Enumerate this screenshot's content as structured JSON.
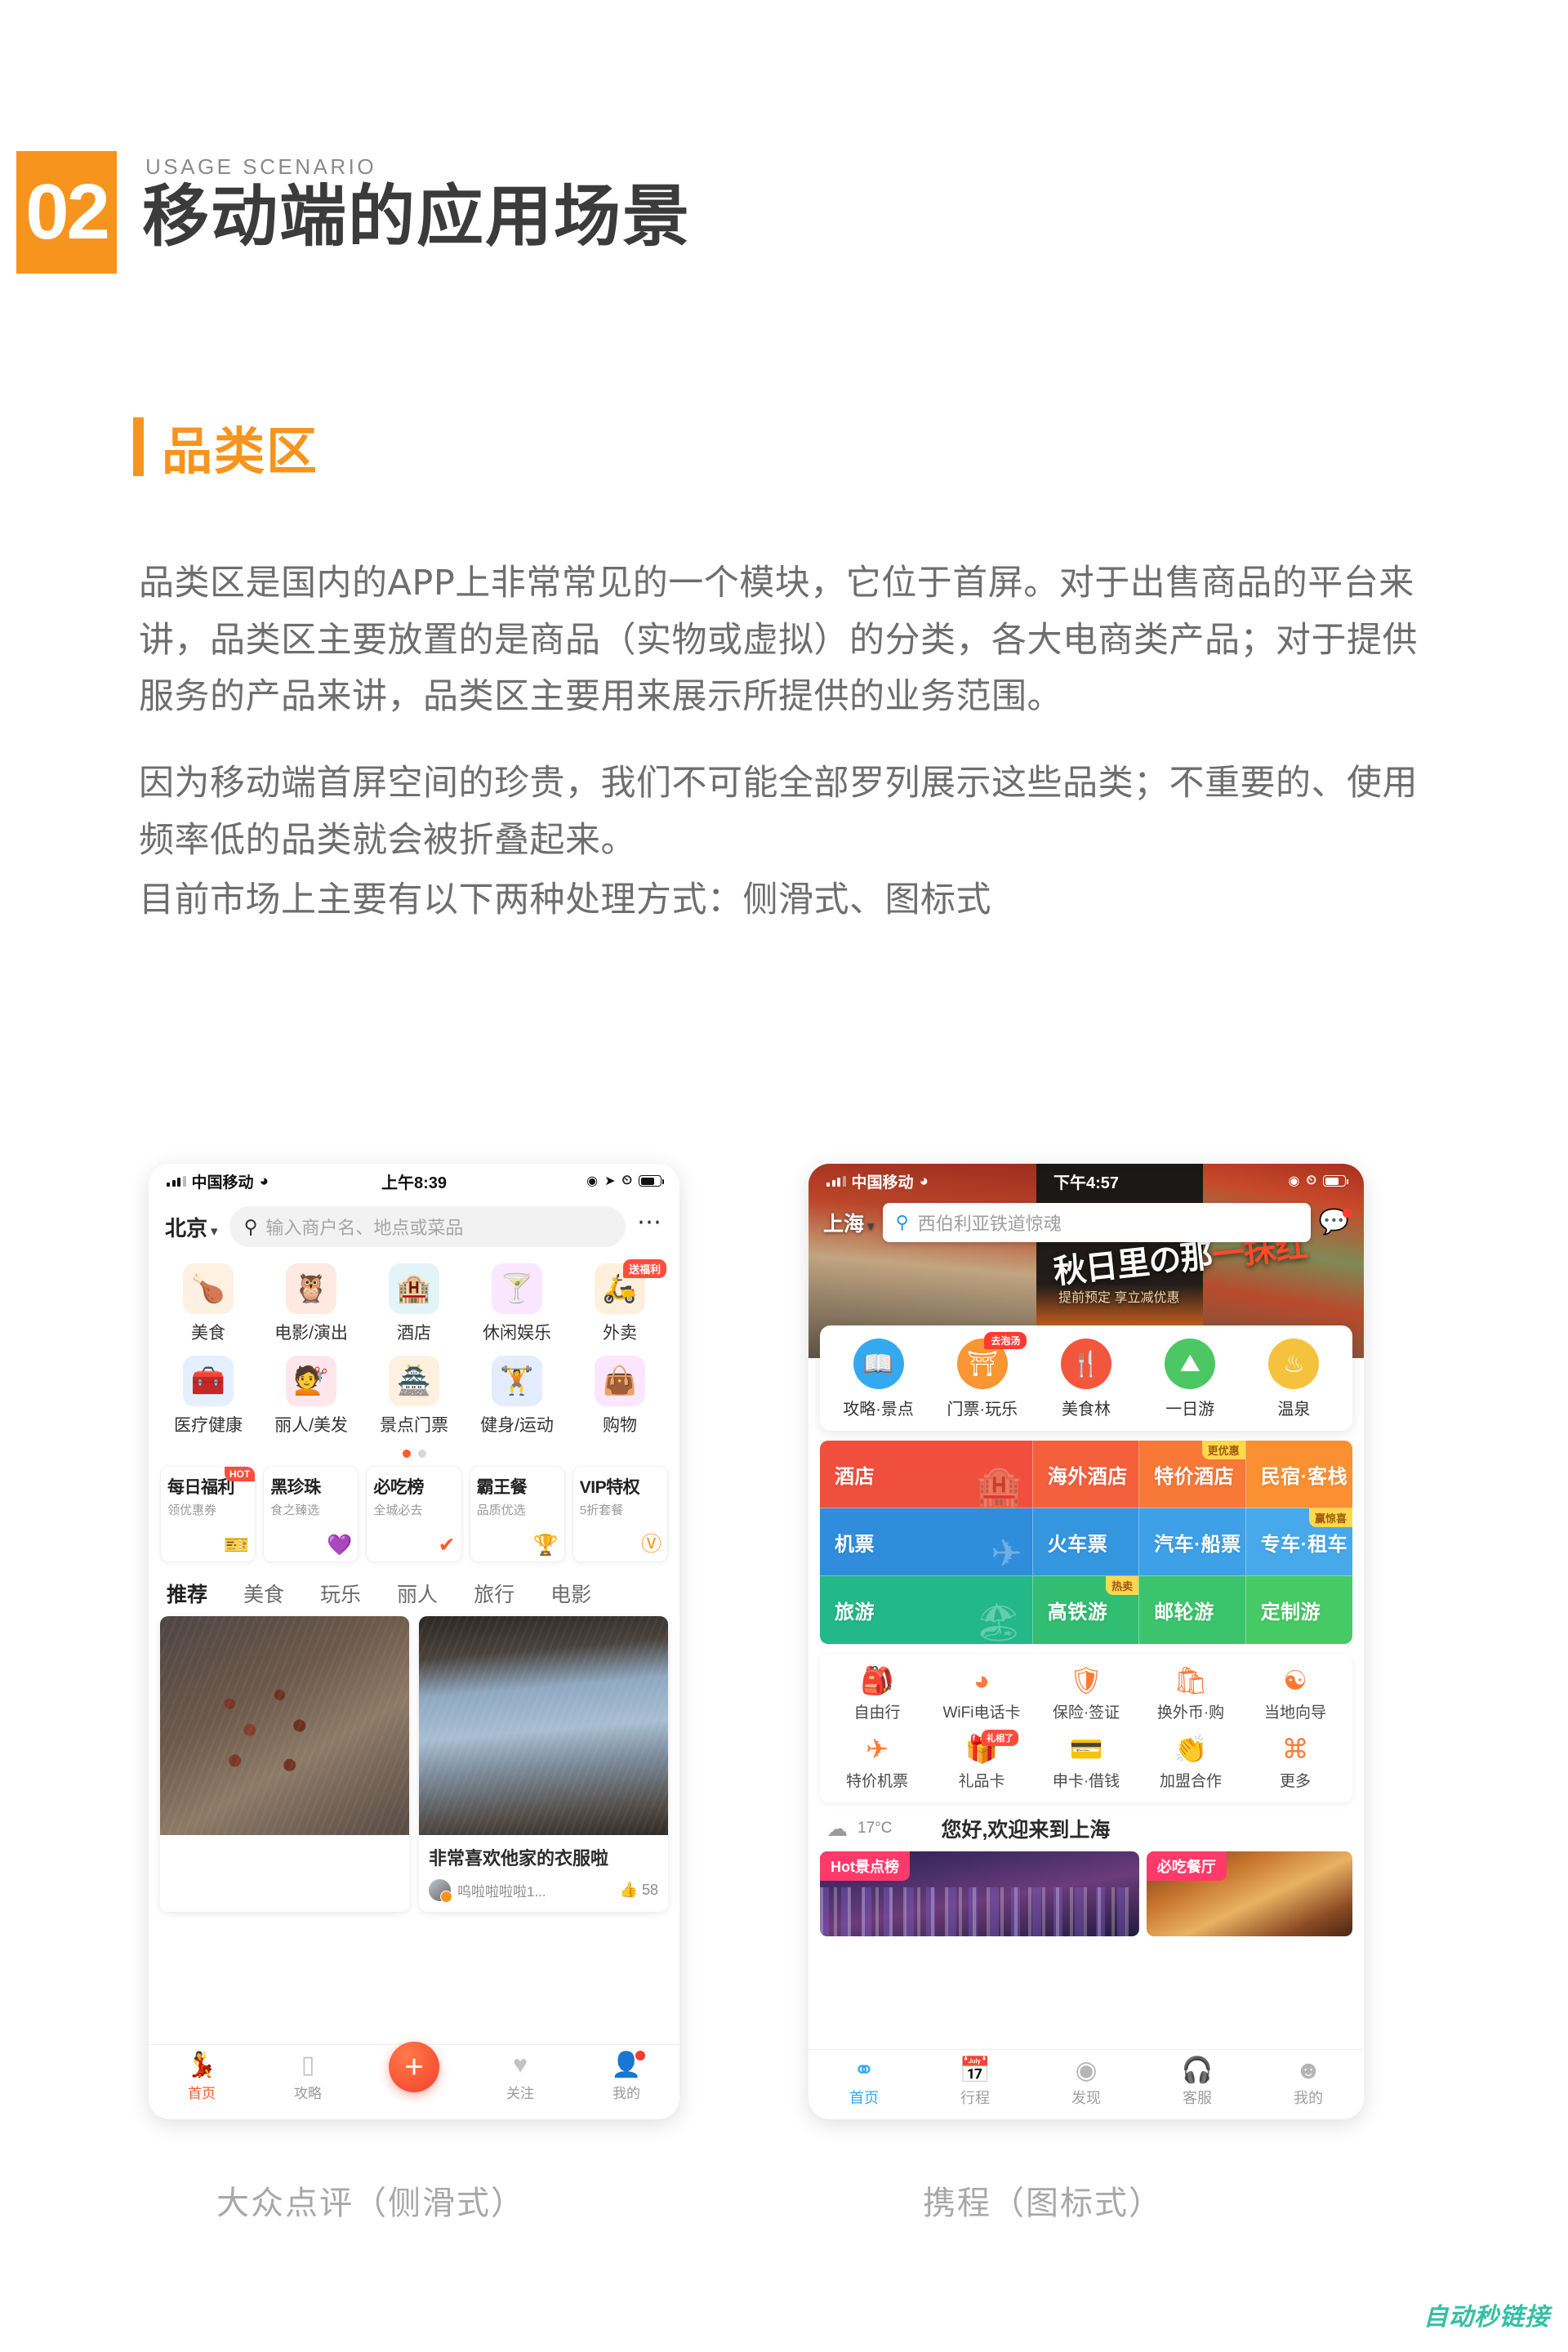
{
  "section": {
    "number": "02",
    "eyebrow": "USAGE SCENARIO",
    "title": "移动端的应用场景",
    "accent_color": "#F7941E"
  },
  "subsection": {
    "title": "品类区",
    "accent_color": "#F7941E"
  },
  "body": {
    "paragraphs": [
      "品类区是国内的APP上非常常见的一个模块，它位于首屏。对于出售商品的平台来讲，品类区主要放置的是商品（实物或虚拟）的分类，各大电商类产品；对于提供服务的产品来讲，品类区主要用来展示所提供的业务范围。",
      "因为移动端首屏空间的珍贵，我们不可能全部罗列展示这些品类；不重要的、使用频率低的品类就会被折叠起来。",
      "目前市场上主要有以下两种处理方式：侧滑式、图标式"
    ]
  },
  "dianping": {
    "caption": "大众点评（侧滑式）",
    "status": {
      "carrier": "中国移动",
      "time": "上午8:39",
      "wifi_icon": "wifi-icon",
      "battery_icon": "battery-icon"
    },
    "topbar": {
      "city": "北京",
      "chevron_icon": "chevron-down-icon",
      "search_icon": "search-icon",
      "search_placeholder": "输入商户名、地点或菜品",
      "more_icon": "more-dots-icon"
    },
    "categories": [
      {
        "label": "美食",
        "icon": "roast-chicken-icon",
        "glyph": "🍗",
        "bg": "#fff1e2",
        "badge": ""
      },
      {
        "label": "电影/演出",
        "icon": "owl-icon",
        "glyph": "🦉",
        "bg": "#ffe9e0",
        "badge": ""
      },
      {
        "label": "酒店",
        "icon": "hotel-icon",
        "glyph": "🏨",
        "bg": "#e2f4f7",
        "badge": ""
      },
      {
        "label": "休闲娱乐",
        "icon": "cocktail-icon",
        "glyph": "🍸",
        "bg": "#fbe6ff",
        "badge": ""
      },
      {
        "label": "外卖",
        "icon": "takeout-icon",
        "glyph": "🛵",
        "bg": "#fff0de",
        "badge": "送福利"
      },
      {
        "label": "医疗健康",
        "icon": "medical-kit-icon",
        "glyph": "🧰",
        "bg": "#e4efff",
        "badge": ""
      },
      {
        "label": "丽人/美发",
        "icon": "hair-salon-icon",
        "glyph": "💇",
        "bg": "#ffe6ec",
        "badge": ""
      },
      {
        "label": "景点门票",
        "icon": "landmark-icon",
        "glyph": "🏯",
        "bg": "#fff0e0",
        "badge": ""
      },
      {
        "label": "健身/运动",
        "icon": "dumbbell-icon",
        "glyph": "🏋",
        "bg": "#e4ecff",
        "badge": ""
      },
      {
        "label": "购物",
        "icon": "shopping-bag-icon",
        "glyph": "👜",
        "bg": "#fce6ff",
        "badge": ""
      }
    ],
    "pager": {
      "total": 2,
      "active": 1
    },
    "promos": [
      {
        "title": "每日福利",
        "sub": "领优惠券",
        "glyph": "🎫",
        "tag": "HOT"
      },
      {
        "title": "黑珍珠",
        "sub": "食之臻选",
        "glyph": "💜",
        "tag": ""
      },
      {
        "title": "必吃榜",
        "sub": "全城必去",
        "glyph": "✔",
        "tag": ""
      },
      {
        "title": "霸王餐",
        "sub": "品质优选",
        "glyph": "🏆",
        "tag": ""
      },
      {
        "title": "VIP特权",
        "sub": "5折套餐",
        "glyph": "🅥",
        "tag": ""
      }
    ],
    "tabs": [
      {
        "label": "推荐",
        "active": true
      },
      {
        "label": "美食",
        "active": false
      },
      {
        "label": "玩乐",
        "active": false
      },
      {
        "label": "丽人",
        "active": false
      },
      {
        "label": "旅行",
        "active": false
      },
      {
        "label": "电影",
        "active": false
      }
    ],
    "feed": [
      {
        "title": "",
        "user": "",
        "likes": "",
        "image": "food"
      },
      {
        "title": "非常喜欢他家的衣服啦",
        "user": "呜啦啦啦啦1...",
        "likes": "58",
        "image": "cloth"
      }
    ],
    "like_icon": "thumbs-up-icon",
    "nav": [
      {
        "label": "首页",
        "icon": "dianping-logo-icon",
        "glyph": "🏃",
        "active": true,
        "dot": false
      },
      {
        "label": "攻略",
        "icon": "guide-book-icon",
        "glyph": "📑",
        "active": false,
        "dot": false
      },
      {
        "label": "关注",
        "icon": "heart-icon",
        "glyph": "♥",
        "active": false,
        "dot": false
      },
      {
        "label": "我的",
        "icon": "profile-icon",
        "glyph": "👤",
        "active": false,
        "dot": true
      }
    ],
    "fab": {
      "label": "+",
      "icon": "plus-icon"
    }
  },
  "ctrip": {
    "caption": "携程（图标式）",
    "status": {
      "carrier": "中国移动",
      "time": "下午4:57",
      "wifi_icon": "wifi-icon",
      "battery_icon": "battery-icon"
    },
    "topbar": {
      "city": "上海",
      "chevron_icon": "chevron-down-icon",
      "search_icon": "search-icon",
      "search_value": "西伯利亚铁道惊魂",
      "message_icon": "message-icon"
    },
    "hero": {
      "title_main": "秋日里の那",
      "title_accent": "一抹红",
      "subtitle": "提前预定 享立减优惠"
    },
    "round_entries": [
      {
        "label": "攻略·景点",
        "icon": "guide-icon",
        "glyph": "📖",
        "bg": "#35a9f0",
        "tag": ""
      },
      {
        "label": "门票·玩乐",
        "icon": "ticket-gate-icon",
        "glyph": "⛩",
        "bg": "#f79632",
        "tag": "去泡汤"
      },
      {
        "label": "美食林",
        "icon": "gourmet-icon",
        "glyph": "🍴",
        "bg": "#f2563d",
        "tag": ""
      },
      {
        "label": "一日游",
        "icon": "mountain-icon",
        "glyph": "⛰",
        "bg": "#4cc763",
        "tag": ""
      },
      {
        "label": "温泉",
        "icon": "hot-spring-icon",
        "glyph": "♨",
        "bg": "#f5c23e",
        "tag": ""
      }
    ],
    "tiles": [
      {
        "label": "酒店",
        "bg": "#f04f3e",
        "ghost": "🏨",
        "tag": ""
      },
      {
        "label": "海外酒店",
        "bg": "#f4603b",
        "ghost": "",
        "tag": ""
      },
      {
        "label": "特价酒店",
        "bg": "#f87838",
        "ghost": "",
        "tag": "更优惠"
      },
      {
        "label": "民宿·客栈",
        "bg": "#fa9032",
        "ghost": "",
        "tag": ""
      },
      {
        "label": "机票",
        "bg": "#2f8ddb",
        "ghost": "✈",
        "tag": ""
      },
      {
        "label": "火车票",
        "bg": "#3596e0",
        "ghost": "",
        "tag": ""
      },
      {
        "label": "汽车·船票",
        "bg": "#3ea0e6",
        "ghost": "",
        "tag": ""
      },
      {
        "label": "专车·租车",
        "bg": "#47a9ea",
        "ghost": "",
        "tag": "赢惊喜"
      },
      {
        "label": "旅游",
        "bg": "#22b887",
        "ghost": "🏖",
        "tag": ""
      },
      {
        "label": "高铁游",
        "bg": "#31be72",
        "ghost": "",
        "tag": "热卖"
      },
      {
        "label": "邮轮游",
        "bg": "#3cc46c",
        "ghost": "",
        "tag": ""
      },
      {
        "label": "定制游",
        "bg": "#46ca66",
        "ghost": "",
        "tag": ""
      }
    ],
    "small_entries": [
      {
        "label": "自由行",
        "icon": "backpack-icon",
        "glyph": "🎒",
        "tag": ""
      },
      {
        "label": "WiFi电话卡",
        "icon": "wifi-icon",
        "glyph": "📶",
        "tag": ""
      },
      {
        "label": "保险·签证",
        "icon": "shield-icon",
        "glyph": "🛡",
        "tag": ""
      },
      {
        "label": "换外币·购",
        "icon": "currency-exchange-icon",
        "glyph": "💱",
        "tag": ""
      },
      {
        "label": "当地向导",
        "icon": "local-guide-icon",
        "glyph": "🧭",
        "tag": ""
      },
      {
        "label": "特价机票",
        "icon": "airplane-icon",
        "glyph": "✈",
        "tag": ""
      },
      {
        "label": "礼品卡",
        "icon": "gift-card-icon",
        "glyph": "🎁",
        "tag": "礼相了"
      },
      {
        "label": "申卡·借钱",
        "icon": "credit-card-icon",
        "glyph": "💳",
        "tag": ""
      },
      {
        "label": "加盟合作",
        "icon": "handshake-icon",
        "glyph": "🤝",
        "tag": ""
      },
      {
        "label": "更多",
        "icon": "grid-more-icon",
        "glyph": "⌘",
        "tag": ""
      }
    ],
    "weather": {
      "icon": "cloud-icon",
      "temperature": "17°C",
      "greeting": "您好,欢迎来到上海"
    },
    "banners": [
      {
        "tag": "Hot景点榜",
        "image": "city-skyline"
      },
      {
        "tag": "必吃餐厅",
        "image": "food-platter"
      }
    ],
    "nav": [
      {
        "label": "首页",
        "icon": "ctrip-home-icon",
        "glyph": "🏠",
        "active": true
      },
      {
        "label": "行程",
        "icon": "calendar-icon",
        "glyph": "📅",
        "active": false
      },
      {
        "label": "发现",
        "icon": "planet-icon",
        "glyph": "🪐",
        "active": false
      },
      {
        "label": "客服",
        "icon": "headset-icon",
        "glyph": "🎧",
        "active": false
      },
      {
        "label": "我的",
        "icon": "profile-icon",
        "glyph": "👤",
        "active": false
      }
    ]
  },
  "watermark": {
    "text": "自动秒链接",
    "color": "#35bfa4"
  }
}
